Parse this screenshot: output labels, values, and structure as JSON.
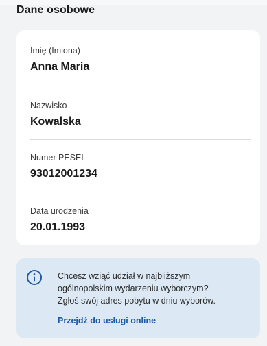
{
  "section": {
    "title": "Dane osobowe"
  },
  "fields": [
    {
      "label": "Imię (Imiona)",
      "value": "Anna Maria"
    },
    {
      "label": "Nazwisko",
      "value": "Kowalska"
    },
    {
      "label": "Numer PESEL",
      "value": "93012001234"
    },
    {
      "label": "Data urodzenia",
      "value": "20.01.1993"
    }
  ],
  "info": {
    "icon": "info-icon",
    "lines": [
      "Chcesz wziąć udział w najbliższym",
      "ogólnopolskim wydarzeniu wyborczym?",
      "Zgłoś swój adres pobytu w dniu wyborów."
    ],
    "link_label": "Przejdź do usługi online"
  },
  "colors": {
    "background": "#f2f3f5",
    "card": "#ffffff",
    "info_background": "#dce9f5",
    "link": "#1d5aa3",
    "icon": "#1d5aa3"
  }
}
